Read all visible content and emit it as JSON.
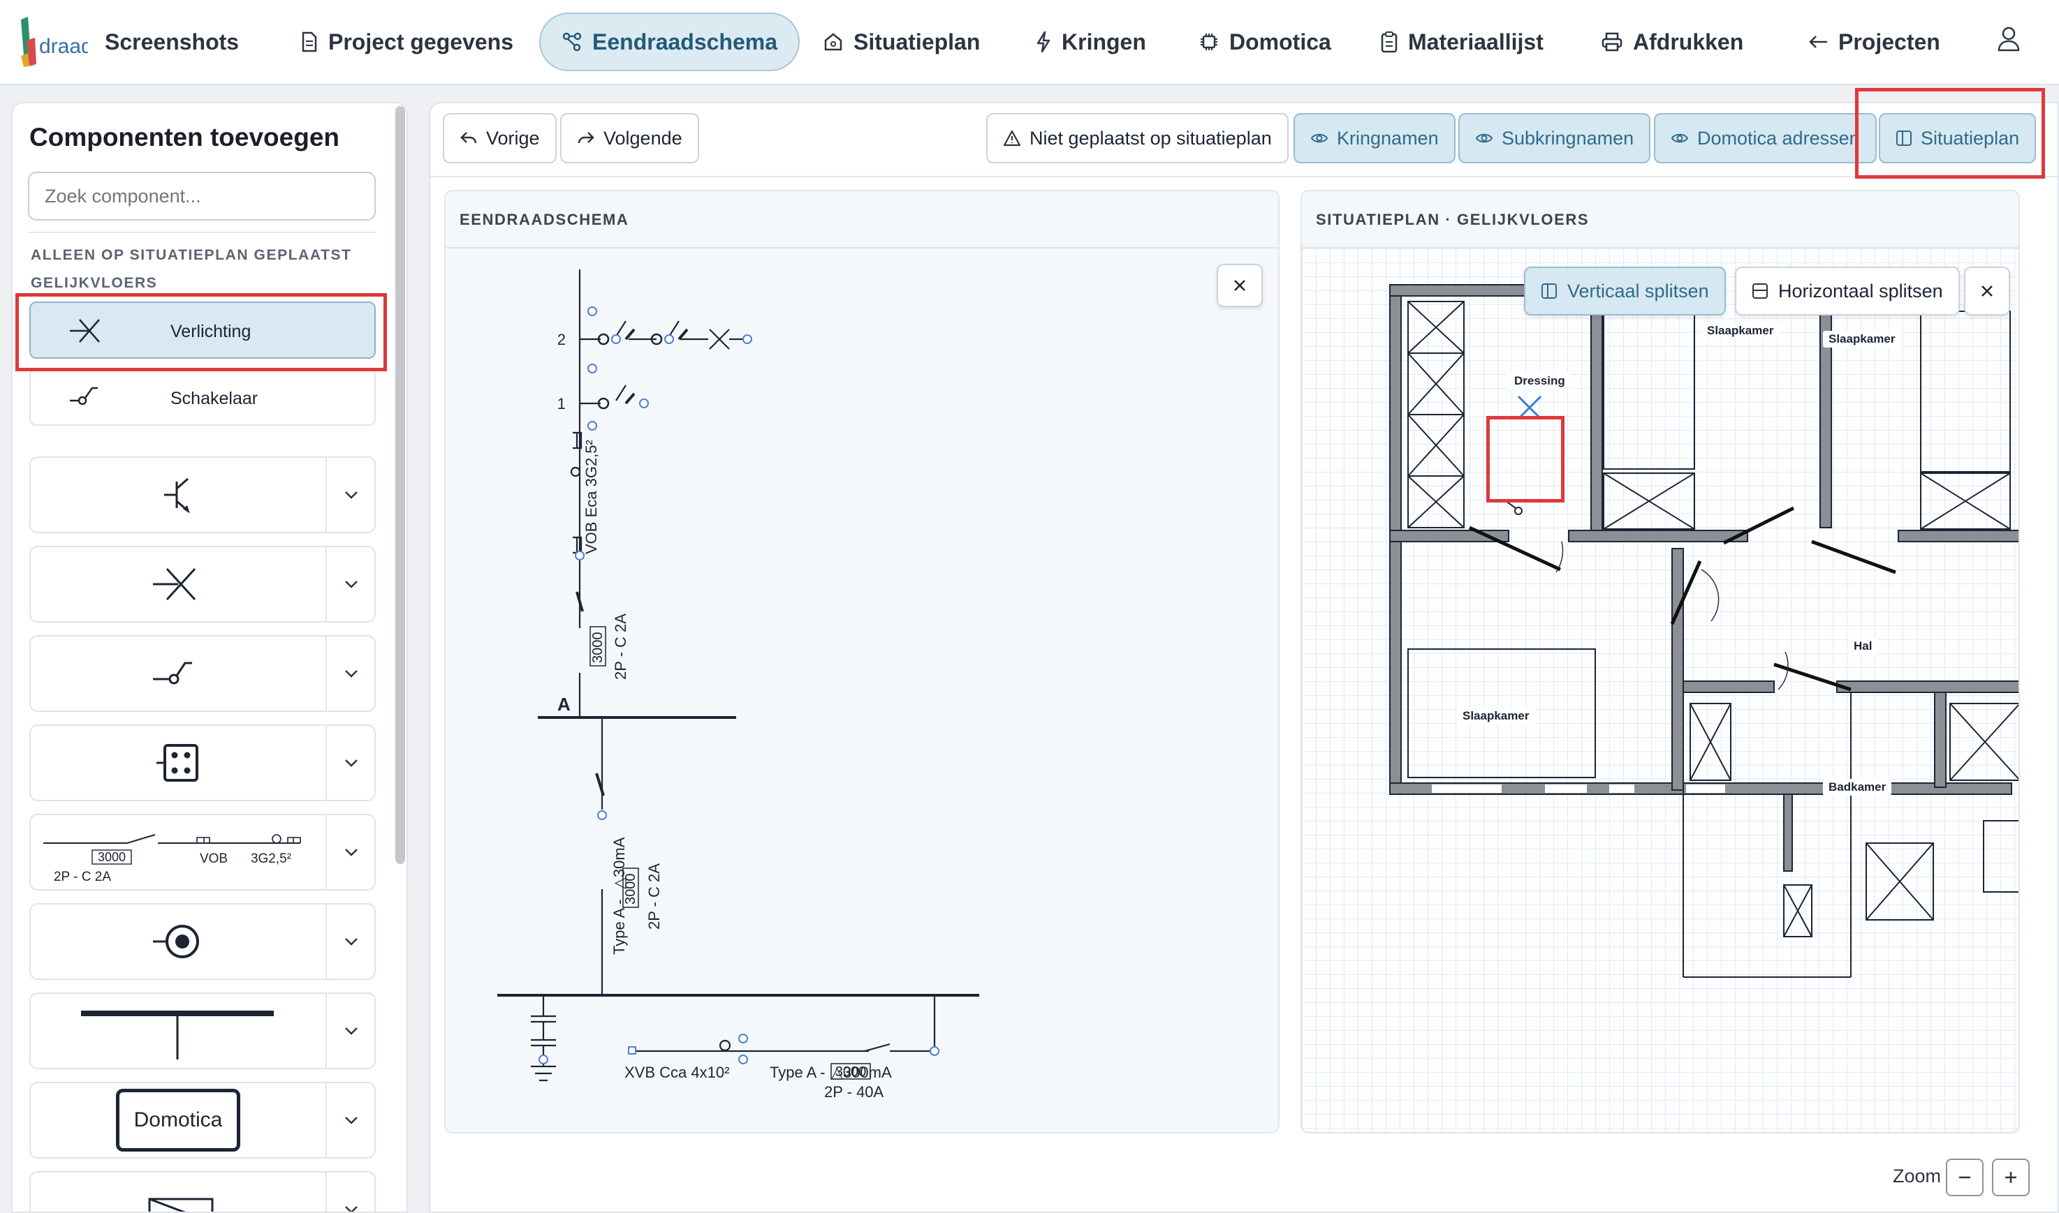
{
  "app": {
    "brand": "draad",
    "colors": {
      "accent": "#2f6b8a",
      "accent_bg": "#d6e8f1",
      "highlight": "#e0383b",
      "wall": "#8c9096"
    }
  },
  "nav": {
    "screenshots": "Screenshots",
    "project": "Project gegevens",
    "eendraadschema": "Eendraadschema",
    "situatieplan": "Situatieplan",
    "kringen": "Kringen",
    "domotica": "Domotica",
    "materiaallijst": "Materiaallijst",
    "afdrukken": "Afdrukken",
    "projecten": "Projecten",
    "active": "Eendraadschema"
  },
  "sidebar": {
    "title": "Componenten toevoegen",
    "search_placeholder": "Zoek component...",
    "group_label": "ALLEEN OP SITUATIEPLAN GEPLAATST",
    "floor_label": "GELIJKVLOERS",
    "placed_items": [
      {
        "label": "Verlichting",
        "icon": "light-fixture-icon",
        "selected": true
      },
      {
        "label": "Schakelaar",
        "icon": "switch-icon",
        "selected": false
      }
    ],
    "components": [
      {
        "icon": "transistor-symbol-icon"
      },
      {
        "icon": "light-point-icon"
      },
      {
        "icon": "switch-symbol-icon"
      },
      {
        "icon": "socket-box-icon"
      },
      {
        "icon": "circuit-line-icon",
        "text": {
          "rating": "3000",
          "breaker": "2P - C 2A",
          "cable": "VOB",
          "section": "3G2,5²"
        }
      },
      {
        "icon": "target-point-icon"
      },
      {
        "icon": "busbar-icon"
      },
      {
        "icon": "domotica-block-icon",
        "text": {
          "label": "Domotica"
        }
      },
      {
        "icon": "envelope-symbol-icon"
      }
    ]
  },
  "toolbar": {
    "prev": "Vorige",
    "next": "Volgende",
    "not_placed": "Niet geplaatst op situatieplan",
    "kringnamen": "Kringnamen",
    "subkringnamen": "Subkringnamen",
    "domotica_adressen": "Domotica adressen",
    "situatieplan": "Situatieplan"
  },
  "schema": {
    "title": "EENDRAADSCHEMA",
    "labels": {
      "num2": "2",
      "num1": "1",
      "cable1": "VOB Eca 3G2,5²",
      "rating1": "3000",
      "breaker1": "2P - C 2A",
      "busA": "A",
      "diff_type": "Type A -",
      "diff_ma": "△30mA",
      "rating2": "3000",
      "breaker2": "2P - C 2A",
      "main_cable": "XVB Cca 4x10²",
      "main_type": "Type A -",
      "main_ma": "△300mA",
      "main_rating": "3000",
      "main_breaker": "2P - 40A"
    }
  },
  "plan": {
    "title": "SITUATIEPLAN · GELIJKVLOERS",
    "split_vertical": "Verticaal splitsen",
    "split_horizontal": "Horizontaal splitsen",
    "rooms": {
      "dressing": "Dressing",
      "slaapkamer1": "Slaapkamer",
      "slaapkamer2": "Slaapkamer",
      "slaapkamer3": "Slaapkamer",
      "hal": "Hal",
      "badkamer": "Badkamer"
    }
  },
  "footer": {
    "zoom_label": "Zoom",
    "zoom_out": "−",
    "zoom_in": "+"
  }
}
